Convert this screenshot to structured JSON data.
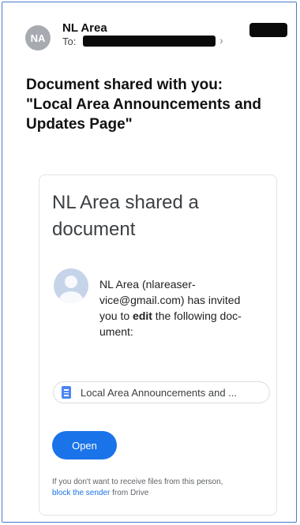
{
  "header": {
    "avatar_initials": "NA",
    "sender_name": "NL Area",
    "to_label": "To:",
    "chevron": "›"
  },
  "email": {
    "subject_line1": "Document shared with you:",
    "subject_line2": "\"Local Area Announcements and",
    "subject_line3": "Updates Page\""
  },
  "card": {
    "title": "NL Area shared a document",
    "invite_before": "NL Area (nlareaser-vice@gmail.com) has invited you to ",
    "invite_bold": "edit",
    "invite_after": " the following doc-ument:",
    "document_chip": "Local Area Announcements and ...",
    "open_button": "Open",
    "footer_text": "If you don't want to receive files from this person,",
    "block_link": "block the sender",
    "footer_after": " from Drive"
  },
  "colors": {
    "frame_border": "#4a78c8",
    "button_blue": "#1a73e8",
    "avatar_gray": "#a7abb1",
    "doc_icon_blue": "#4a85f4"
  },
  "icons": [
    "avatar",
    "chevron-right-icon",
    "profile-placeholder-icon",
    "google-docs-icon"
  ]
}
